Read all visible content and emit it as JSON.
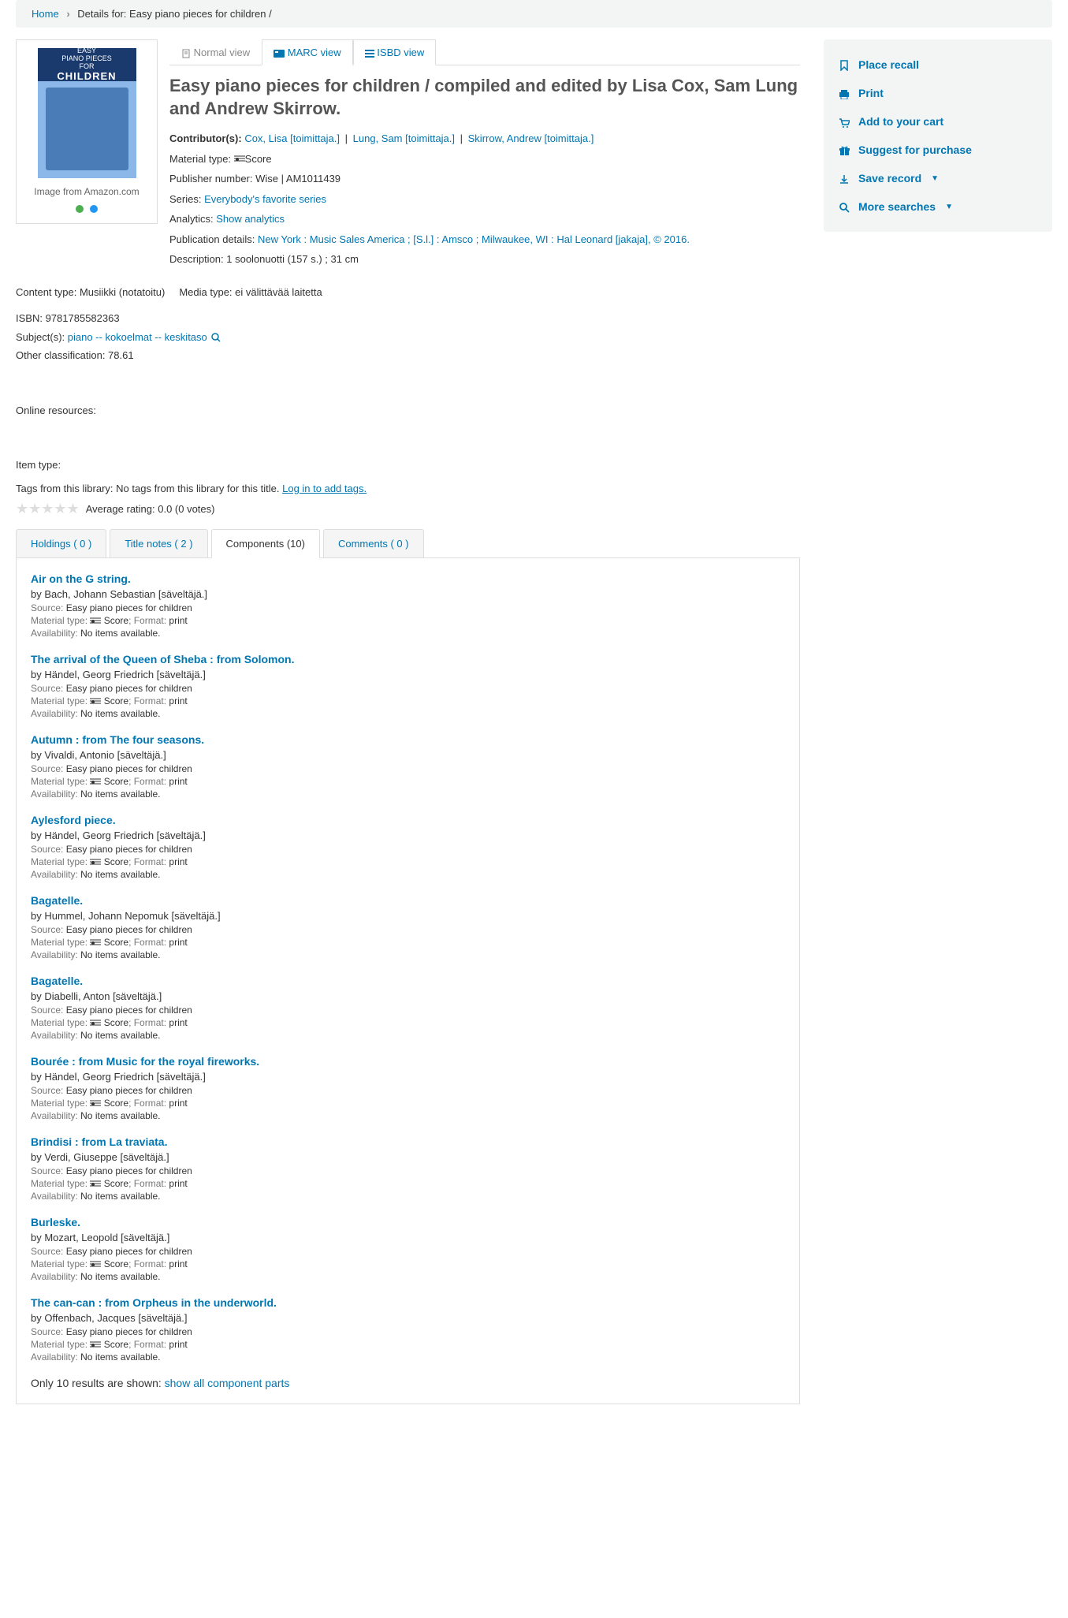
{
  "breadcrumb": {
    "home": "Home",
    "details": "Details for: Easy piano pieces for children /"
  },
  "cover": {
    "caption": "Image from Amazon.com"
  },
  "viewTabs": {
    "normal": "Normal view",
    "marc": "MARC view",
    "isbd": "ISBD view"
  },
  "title": "Easy piano pieces for children / compiled and edited by Lisa Cox, Sam Lung and Andrew Skirrow.",
  "labels": {
    "contributors": "Contributor(s): ",
    "materialType": "Material type: ",
    "publisherNumber": "Publisher number: ",
    "series": "Series: ",
    "analytics": "Analytics: ",
    "publicationDetails": "Publication details: ",
    "description": "Description: ",
    "contentType": "Content type: ",
    "mediaType": "Media type: ",
    "isbn": "ISBN: ",
    "subjects": "Subject(s): ",
    "otherClass": "Other classification: ",
    "onlineRes": "Online resources:",
    "itemType": "Item type:",
    "tagsFrom": "Tags from this library: ",
    "noTags": "No tags from this library for this title. ",
    "loginTags": "Log in to add tags.",
    "avgRating": "Average rating: 0.0 (0 votes)",
    "source": "Source: ",
    "format": "; Format: ",
    "availability": "Availability: ",
    "onlyShown": "Only 10 results are shown: ",
    "showAll": "show all component parts"
  },
  "contributors": [
    {
      "name": "Cox, Lisa",
      "role": "[toimittaja.]"
    },
    {
      "name": "Lung, Sam",
      "role": "[toimittaja.]"
    },
    {
      "name": "Skirrow, Andrew",
      "role": "[toimittaja.]"
    }
  ],
  "materialTypeVal": "Score",
  "publisherNumberVal": "Wise | AM1011439",
  "seriesVal": "Everybody's favorite series",
  "analyticsVal": "Show analytics",
  "pubDetails": {
    "p1": "New York : ",
    "p2": "Music Sales America ; ",
    "p3": "[S.l.] : ",
    "p4": "Amsco ; ",
    "p5": "Milwaukee, WI : ",
    "p6": "Hal Leonard [jakaja], ",
    "p7": "© 2016."
  },
  "descriptionVal": "1 soolonuotti (157 s.) ; 31 cm",
  "contentTypeVal": "Musiikki (notatoitu)",
  "mediaTypeVal": "ei välittävää laitetta",
  "isbnVal": "9781785582363",
  "subjectsVal": "piano -- kokoelmat -- keskitaso",
  "otherClassVal": "78.61",
  "detailTabs": {
    "holdings": "Holdings ( 0 )",
    "titleNotes": "Title notes ( 2 )",
    "components": "Components (10)",
    "comments": "Comments ( 0 )"
  },
  "components": [
    {
      "title": "Air on the G string.",
      "by": "by Bach, Johann Sebastian [säveltäjä.]",
      "source": "Easy piano pieces for children",
      "mtype": " Score",
      "format": "print",
      "avail": "No items available."
    },
    {
      "title": "The arrival of the Queen of Sheba : from Solomon.",
      "by": "by Händel, Georg Friedrich [säveltäjä.]",
      "source": "Easy piano pieces for children",
      "mtype": " Score",
      "format": "print",
      "avail": "No items available."
    },
    {
      "title": "Autumn : from The four seasons.",
      "by": "by Vivaldi, Antonio [säveltäjä.]",
      "source": "Easy piano pieces for children",
      "mtype": " Score",
      "format": "print",
      "avail": "No items available."
    },
    {
      "title": "Aylesford piece.",
      "by": "by Händel, Georg Friedrich [säveltäjä.]",
      "source": "Easy piano pieces for children",
      "mtype": " Score",
      "format": "print",
      "avail": "No items available."
    },
    {
      "title": "Bagatelle.",
      "by": "by Hummel, Johann Nepomuk [säveltäjä.]",
      "source": "Easy piano pieces for children",
      "mtype": " Score",
      "format": "print",
      "avail": "No items available."
    },
    {
      "title": "Bagatelle.",
      "by": "by Diabelli, Anton [säveltäjä.]",
      "source": "Easy piano pieces for children",
      "mtype": " Score",
      "format": "print",
      "avail": "No items available."
    },
    {
      "title": "Bourée : from Music for the royal fireworks.",
      "by": "by Händel, Georg Friedrich [säveltäjä.]",
      "source": "Easy piano pieces for children",
      "mtype": " Score",
      "format": "print",
      "avail": "No items available."
    },
    {
      "title": "Brindisi : from La traviata.",
      "by": "by Verdi, Giuseppe [säveltäjä.]",
      "source": "Easy piano pieces for children",
      "mtype": " Score",
      "format": "print",
      "avail": "No items available."
    },
    {
      "title": "Burleske.",
      "by": "by Mozart, Leopold [säveltäjä.]",
      "source": "Easy piano pieces for children",
      "mtype": " Score",
      "format": "print",
      "avail": "No items available."
    },
    {
      "title": "The can-can : from Orpheus in the underworld.",
      "by": "by Offenbach, Jacques [säveltäjä.]",
      "source": "Easy piano pieces for children",
      "mtype": " Score",
      "format": "print",
      "avail": "No items available."
    }
  ],
  "sidebar": {
    "placeRecall": "Place recall",
    "print": "Print",
    "addCart": "Add to your cart",
    "suggest": "Suggest for purchase",
    "saveRecord": "Save record",
    "moreSearches": "More searches"
  }
}
